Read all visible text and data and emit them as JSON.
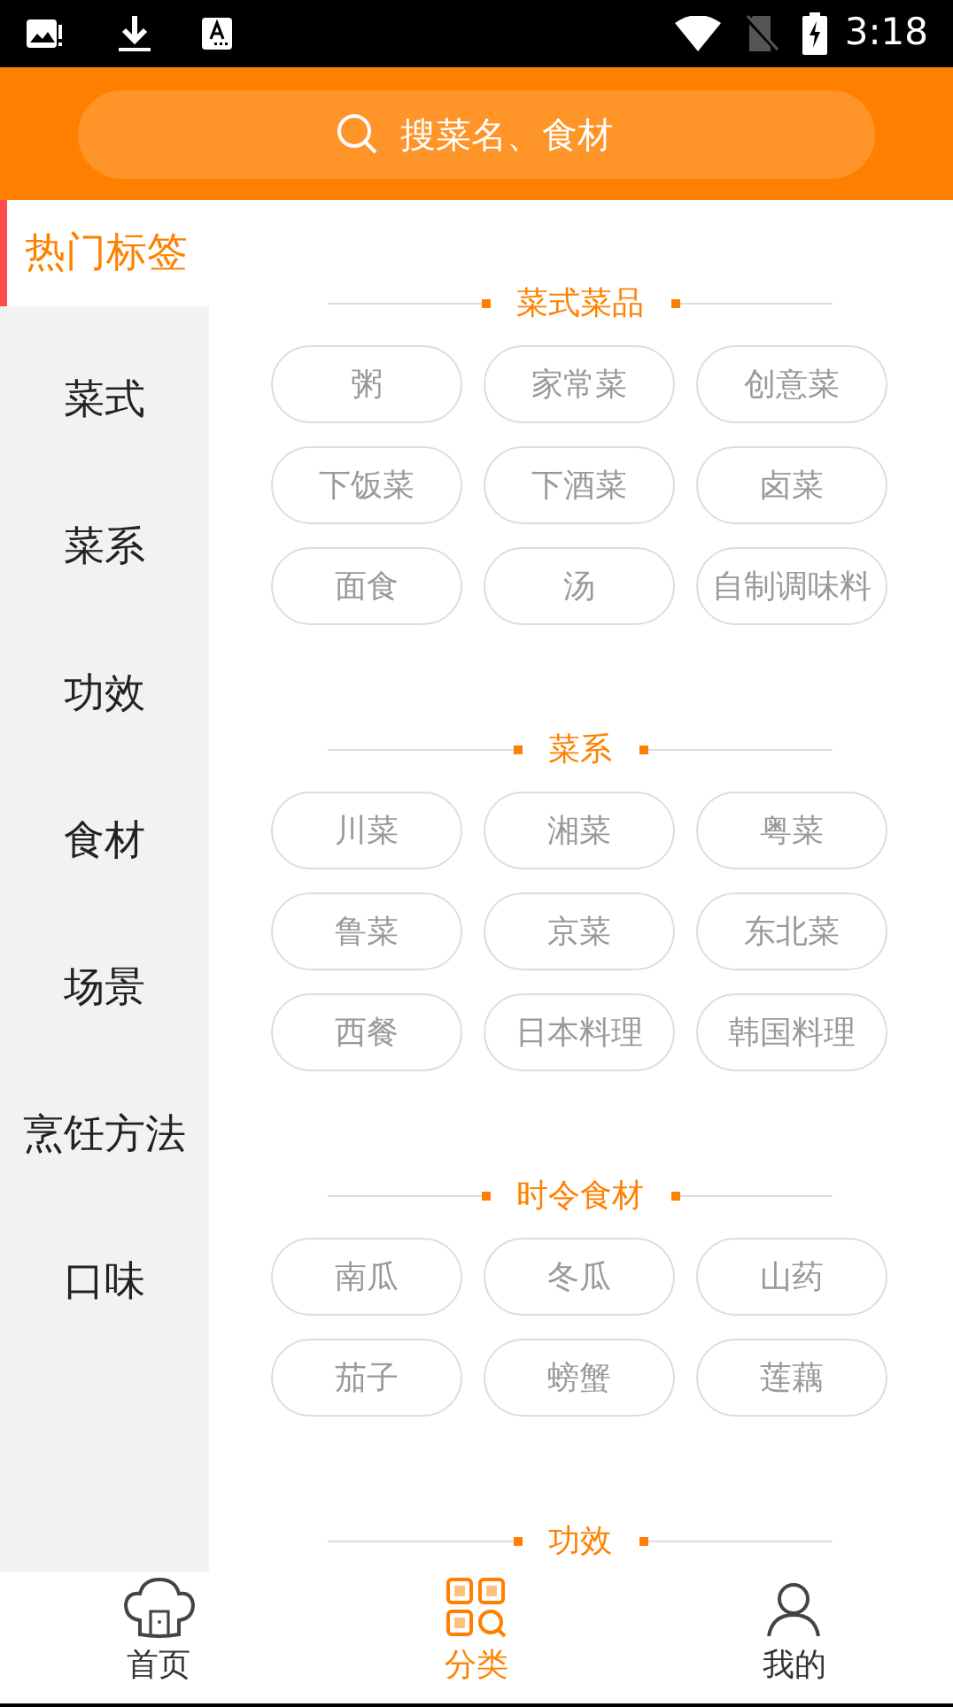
{
  "status_bar": {
    "time": "3:18"
  },
  "search": {
    "placeholder": "搜菜名、食材"
  },
  "sidebar": {
    "items": [
      {
        "label": "热门标签",
        "selected": true
      },
      {
        "label": "菜式",
        "selected": false
      },
      {
        "label": "菜系",
        "selected": false
      },
      {
        "label": "功效",
        "selected": false
      },
      {
        "label": "食材",
        "selected": false
      },
      {
        "label": "场景",
        "selected": false
      },
      {
        "label": "烹饪方法",
        "selected": false
      },
      {
        "label": "口味",
        "selected": false
      }
    ]
  },
  "sections": [
    {
      "title": "菜式菜品",
      "tags": [
        "粥",
        "家常菜",
        "创意菜",
        "下饭菜",
        "下酒菜",
        "卤菜",
        "面食",
        "汤",
        "自制调味料"
      ]
    },
    {
      "title": "菜系",
      "tags": [
        "川菜",
        "湘菜",
        "粤菜",
        "鲁菜",
        "京菜",
        "东北菜",
        "西餐",
        "日本料理",
        "韩国料理"
      ]
    },
    {
      "title": "时令食材",
      "tags": [
        "南瓜",
        "冬瓜",
        "山药",
        "茄子",
        "螃蟹",
        "莲藕"
      ]
    },
    {
      "title": "功效"
    }
  ],
  "bottom_nav": [
    {
      "label": "首页",
      "kind": "home",
      "selected": false
    },
    {
      "label": "分类",
      "kind": "category",
      "selected": true
    },
    {
      "label": "我的",
      "kind": "profile",
      "selected": false
    }
  ]
}
